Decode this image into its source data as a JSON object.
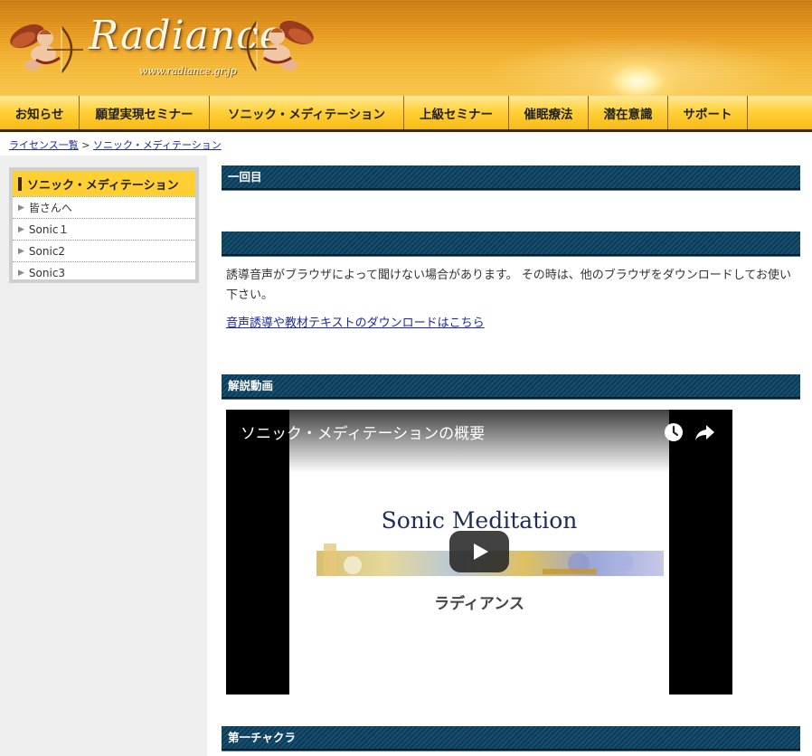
{
  "header": {
    "logo_text": "Radiance",
    "logo_url": "www.radiance.gr.jp"
  },
  "nav": {
    "items": [
      {
        "label": "お知らせ"
      },
      {
        "label": "願望実現セミナー"
      },
      {
        "label": "ソニック・メディテーション"
      },
      {
        "label": "上級セミナー"
      },
      {
        "label": "催眠療法"
      },
      {
        "label": "潜在意識"
      },
      {
        "label": "サポート"
      }
    ]
  },
  "breadcrumb": {
    "link1": "ライセンス一覧",
    "separator": ">",
    "link2": "ソニック・メディテーション"
  },
  "sidebar": {
    "title": "ソニック・メディテーション",
    "items": [
      {
        "label": "皆さんへ"
      },
      {
        "label": "Sonic１"
      },
      {
        "label": "Sonic2"
      },
      {
        "label": "Sonic3"
      }
    ]
  },
  "main": {
    "section1_title": "一回目",
    "section2_title": "",
    "notice_text": "誘導音声がブラウザによって聞けない場合があります。 その時は、他のブラウザをダウンロードしてお使い下さい。",
    "download_link": "音声誘導や教材テキストのダウンロードはこちら",
    "section3_title": "解説動画",
    "video": {
      "title": "ソニック・メディテーションの概要",
      "slide_title": "Sonic Meditation",
      "slide_subtitle": "ラディアンス",
      "icons": [
        "watch-later-icon",
        "share-icon",
        "play-icon"
      ]
    },
    "section4_title": "第一チャクラ"
  },
  "colors": {
    "nav_yellow": "#ffd23a",
    "section_bar": "#0f3a57",
    "link": "#1a2aa0",
    "sidebar_head": "#ffcf33"
  }
}
